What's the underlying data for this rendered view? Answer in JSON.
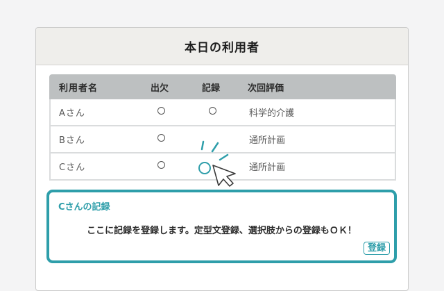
{
  "panel": {
    "title": "本日の利用者"
  },
  "table": {
    "headers": [
      "利用者名",
      "出欠",
      "記録",
      "次回評価"
    ],
    "rows": [
      {
        "name": "Aさん",
        "attendance": "○",
        "record": "○",
        "next": "科学的介護"
      },
      {
        "name": "Bさん",
        "attendance": "○",
        "record": "",
        "next": "通所計画"
      },
      {
        "name": "Cさん",
        "attendance": "○",
        "record": "○",
        "next": "通所計画"
      }
    ]
  },
  "callout": {
    "title": "Cさんの記録",
    "body": "ここに記録を登録します。定型文登録、選択肢からの登録もＯＫ！",
    "button": "登録"
  },
  "colors": {
    "accent": "#2e9eaa",
    "header_bg": "#bdc0c1",
    "panel_header_bg": "#efeeeb"
  },
  "icons": [
    "mouse-pointer-icon",
    "click-sparkle-icon"
  ]
}
